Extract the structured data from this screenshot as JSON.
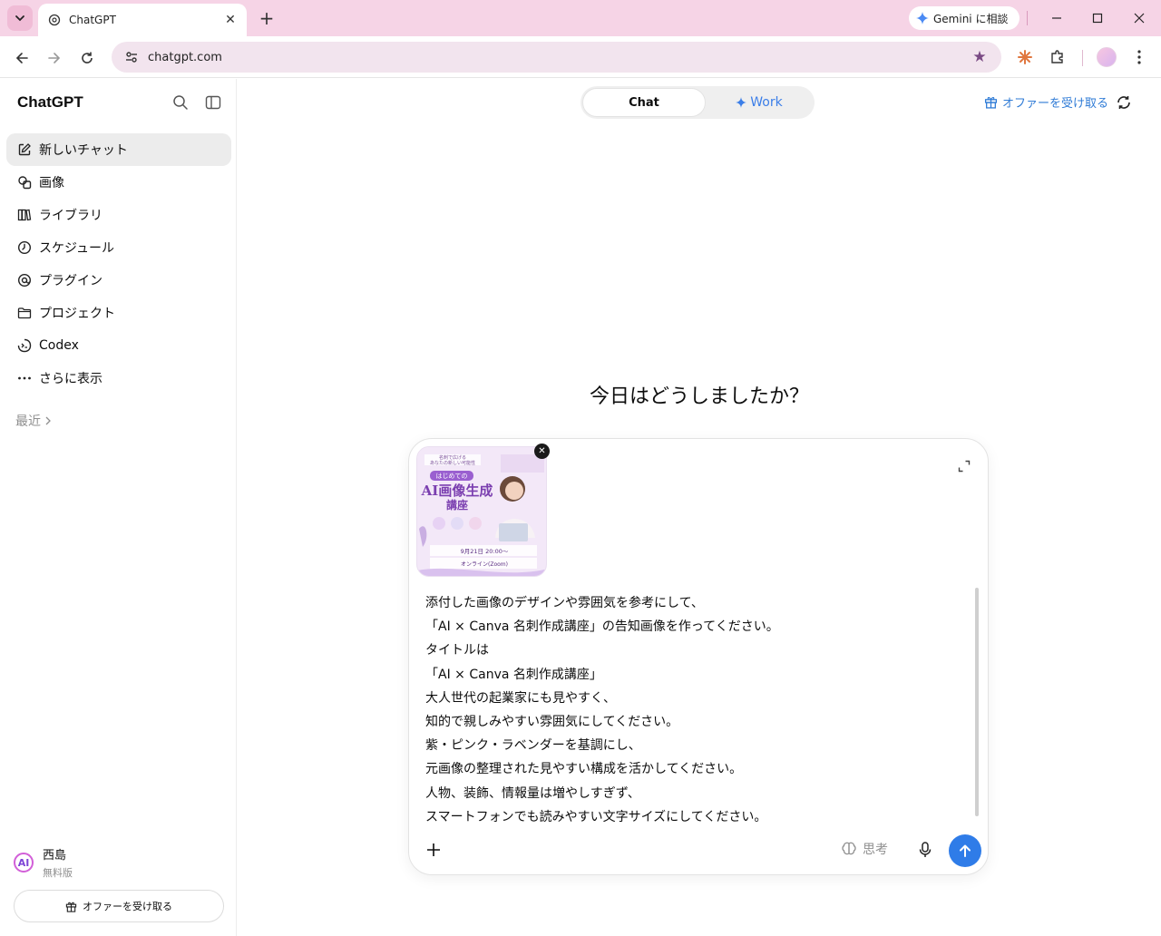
{
  "browser": {
    "tab_title": "ChatGPT",
    "url": "chatgpt.com",
    "gemini_label": "Gemini に相談"
  },
  "sidebar": {
    "brand": "ChatGPT",
    "items": [
      {
        "label": "新しいチャット",
        "icon": "compose-icon"
      },
      {
        "label": "画像",
        "icon": "image-icon"
      },
      {
        "label": "ライブラリ",
        "icon": "library-icon"
      },
      {
        "label": "スケジュール",
        "icon": "clock-icon"
      },
      {
        "label": "プラグイン",
        "icon": "plugin-icon"
      },
      {
        "label": "プロジェクト",
        "icon": "folder-icon"
      },
      {
        "label": "Codex",
        "icon": "codex-icon"
      },
      {
        "label": "さらに表示",
        "icon": "more-icon"
      }
    ],
    "recent_label": "最近",
    "user": {
      "initial": "AI",
      "name": "西島",
      "plan": "無料版"
    },
    "offer_button": "オファーを受け取る"
  },
  "header": {
    "mode_chat": "Chat",
    "mode_work": "Work",
    "offer_link": "オファーを受け取る"
  },
  "main": {
    "greeting": "今日はどうしましたか？"
  },
  "attachment": {
    "line1": "名刺で広げる",
    "line2": "あなたの新しい可能性",
    "badge": "はじめての",
    "title1": "AI画像生成",
    "title2": "講座",
    "date": "9月21日 20:00〜",
    "venue": "オンライン(Zoom)"
  },
  "composer": {
    "prompt_lines": [
      "添付した画像のデザインや雰囲気を参考にして、",
      "「AI × Canva 名刺作成講座」の告知画像を作ってください。",
      "タイトルは",
      "「AI × Canva 名刺作成講座」",
      "大人世代の起業家にも見やすく、",
      "知的で親しみやすい雰囲気にしてください。",
      "紫・ピンク・ラベンダーを基調にし、",
      "元画像の整理された見やすい構成を活かしてください。",
      "人物、装飾、情報量は増やしすぎず、",
      "スマートフォンでも読みやすい文字サイズにしてください。"
    ],
    "think_label": "思考"
  },
  "colors": {
    "accent_blue": "#2f7ce8",
    "titlebar_pink": "#f6d4e6",
    "omnibox": "#f2e4ee"
  }
}
